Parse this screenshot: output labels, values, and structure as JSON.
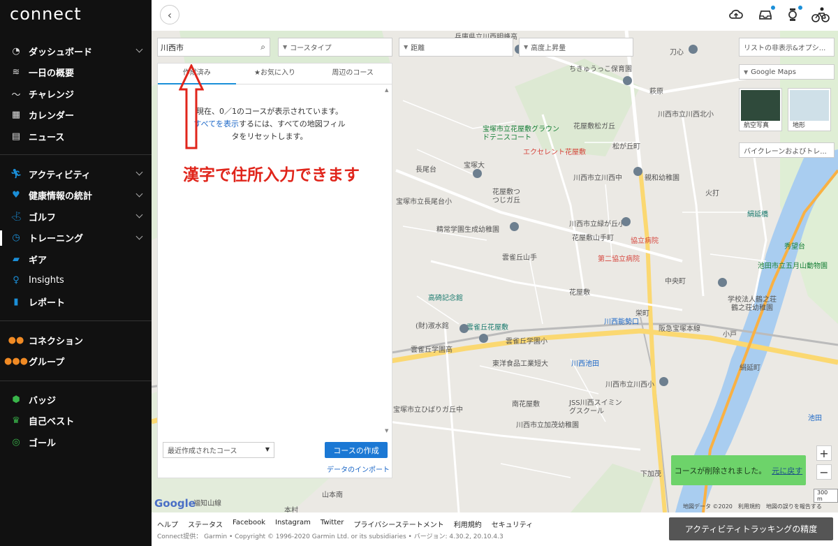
{
  "app": {
    "logo": "connect"
  },
  "sidebar": {
    "group1": [
      {
        "label": "ダッシュボード",
        "icon": "dashboard-icon",
        "chevron": true
      },
      {
        "label": "一日の概要",
        "icon": "layers-icon",
        "chevron": false
      },
      {
        "label": "チャレンジ",
        "icon": "challenge-icon",
        "chevron": false
      },
      {
        "label": "カレンダー",
        "icon": "calendar-icon",
        "chevron": false
      },
      {
        "label": "ニュース",
        "icon": "news-icon",
        "chevron": false
      }
    ],
    "group2": [
      {
        "label": "アクティビティ",
        "icon": "activity-icon",
        "chevron": true
      },
      {
        "label": "健康情報の統計",
        "icon": "heart-icon",
        "chevron": true
      },
      {
        "label": "ゴルフ",
        "icon": "golf-icon",
        "chevron": true
      },
      {
        "label": "トレーニング",
        "icon": "stopwatch-icon",
        "chevron": true,
        "active": true
      },
      {
        "label": "ギア",
        "icon": "shoe-icon",
        "chevron": false
      },
      {
        "label": "Insights",
        "icon": "lightbulb-icon",
        "chevron": false
      },
      {
        "label": "レポート",
        "icon": "bar-chart-icon",
        "chevron": false
      }
    ],
    "group3": [
      {
        "label": "コネクション",
        "icon": "connections-icon"
      },
      {
        "label": "グループ",
        "icon": "group-icon"
      }
    ],
    "group4": [
      {
        "label": "バッジ",
        "icon": "badge-icon"
      },
      {
        "label": "自己ベスト",
        "icon": "trophy-icon"
      },
      {
        "label": "ゴール",
        "icon": "target-icon"
      }
    ]
  },
  "topbar": {
    "icons": [
      "back-chevron-icon",
      "cloud-upload-icon",
      "inbox-icon",
      "watch-icon",
      "avatar-cyclist-icon"
    ]
  },
  "filters": {
    "search_value": "川西市",
    "course_type": "コースタイプ",
    "distance": "距離",
    "elevation": "高度上昇量"
  },
  "panel": {
    "tabs": [
      "作成済み",
      "★お気に入り",
      "周辺のコース"
    ],
    "msg_line1": "現在、0／1のコースが表示されています。",
    "msg_link": "すべてを表示",
    "msg_line2_rest": "するには、すべての地図フィル",
    "msg_line3": "タをリセットします。",
    "sort_value": "最近作成されたコース",
    "create_button": "コースの作成",
    "import_link": "データのインポート"
  },
  "annotation": {
    "text": "漢字で住所入力できます"
  },
  "map_controls": {
    "list_toggle": "リストの非表示&オプシ...",
    "map_type": "Google Maps",
    "thumb_aerial": "航空写真",
    "thumb_terrain": "地形",
    "bike_lanes": "バイクレーンおよびトレ...",
    "zoom_in": "+",
    "zoom_out": "−",
    "scale": "300 m",
    "attribution": "地図データ ©2020　利用規約　地図の誤りを報告する",
    "google": "Google"
  },
  "map_labels": [
    "兵庫県立川西明峰高",
    "ちきゅうっこ保育園",
    "刀心",
    "萩原",
    "川西市立川西北小",
    "宝塚市立花屋敷グラウンドテニスコート",
    "花屋敷松ガ丘",
    "エクセレント花屋敷",
    "松が丘町",
    "宝塚大",
    "長尾台",
    "川西市立川西中",
    "親和幼稚園",
    "火打",
    "花屋敷つつじガ丘",
    "宝塚市立長尾台小",
    "絹延橋",
    "川西市立緑が丘小",
    "精常学園生成幼稚園",
    "花屋敷山手町",
    "協立病院",
    "秀望台",
    "第二協立病院",
    "池田市立五月山動物園",
    "雲雀丘山手",
    "中央町",
    "高碕記念館",
    "花屋敷",
    "学校法人鶴之荘",
    "鶴之荘幼稚園",
    "(財)淑水館",
    "雲雀丘花屋敷",
    "川西能勢口",
    "阪急宝塚本線",
    "雲雀丘学園小",
    "雲雀丘学園高",
    "東洋食品工業短大",
    "川西池田",
    "池田",
    "川西市立川西小",
    "南花屋敷",
    "JSS川西スイミングスクール",
    "宝塚市立ひばりガ丘中",
    "川西市立加茂幼稚園",
    "山本南",
    "下加茂",
    "本村",
    "福知山線",
    "小戸",
    "栄町",
    "絹延町"
  ],
  "footer": {
    "links": [
      "ヘルプ",
      "ステータス",
      "Facebook",
      "Instagram",
      "Twitter",
      "プライバシーステートメント",
      "利用規約",
      "セキュリティ"
    ],
    "copyright": "Connect提供： Garmin • Copyright © 1996-2020 Garmin Ltd. or its subsidiaries • バージョン: 4.30.2, 20.10.4.3",
    "accuracy_button": "アクティビティトラッキングの精度"
  },
  "toast": {
    "message": "コースが削除されました。",
    "undo": "元に戻す"
  },
  "colors": {
    "sidebar_bg": "#111111",
    "accent_blue": "#1b78d4",
    "toast_green": "#6dd36a",
    "annotation_red": "#e0251b"
  }
}
